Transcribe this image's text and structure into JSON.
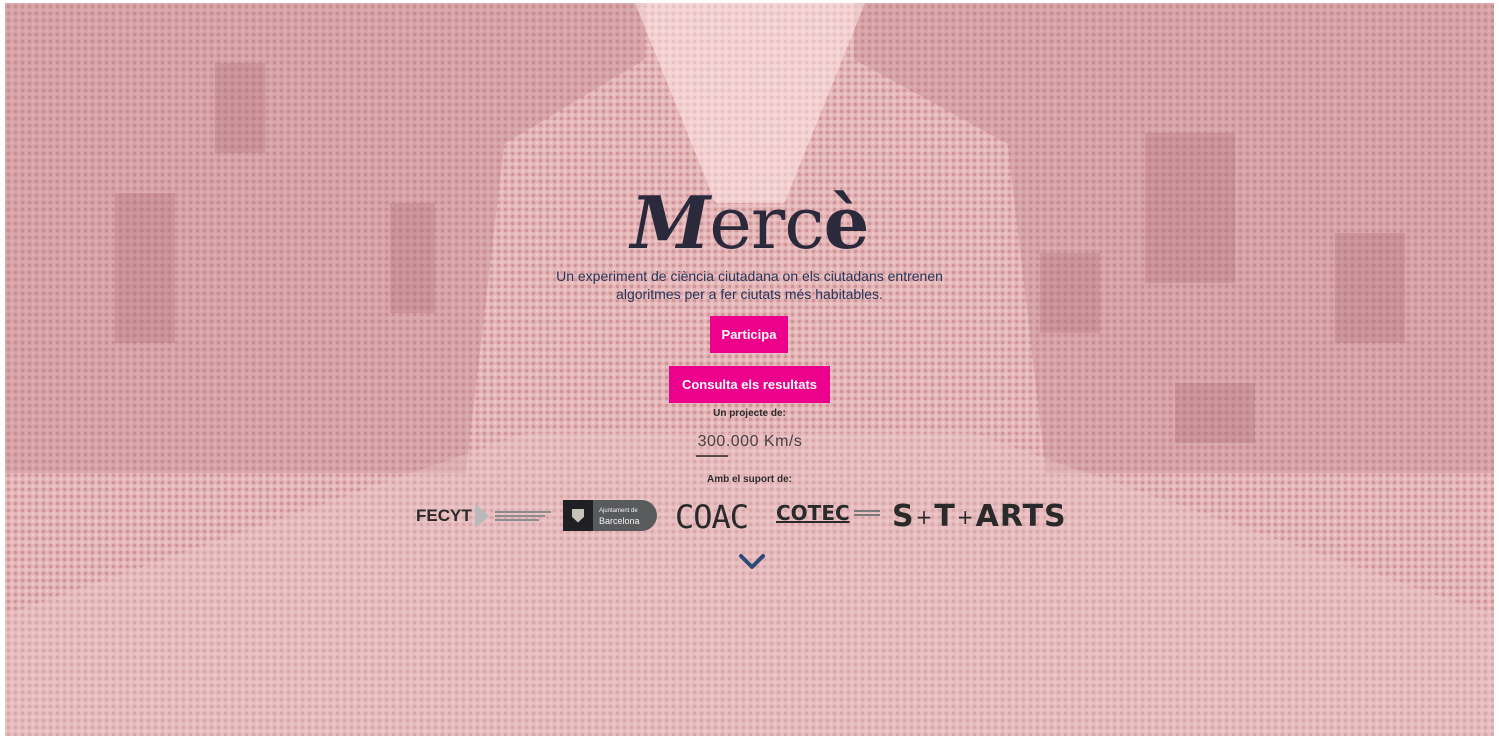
{
  "hero": {
    "logo": {
      "m": "M",
      "rest": "erc",
      "accent": "è"
    },
    "tagline": [
      "Un experiment de ciència ciutadana on els ciutadans entrenen",
      "algoritmes per a fer ciutats més habitables."
    ],
    "buttons": {
      "participa": "Participa",
      "results": "Consulta els resultats"
    },
    "project_label": "Un projecte de:",
    "project_logo": "300.000 Km/s",
    "support_label": "Amb el suport de:",
    "sponsors": {
      "fecyt": "FECYT",
      "ajuntament_small": "Ajuntament de",
      "ajuntament_big": "Barcelona",
      "coac": "COAC",
      "cotec": "COTEC",
      "starts_s": "S",
      "starts_t": "T",
      "starts_arts": "ARTS",
      "plus": "+"
    },
    "scroll_icon": "chevron-down-icon"
  },
  "colors": {
    "accent": "#ec008c",
    "background": "#e6b7b8",
    "logo": "#2b2a3d",
    "tagline": "#27355a",
    "chevron": "#2d4b77"
  }
}
